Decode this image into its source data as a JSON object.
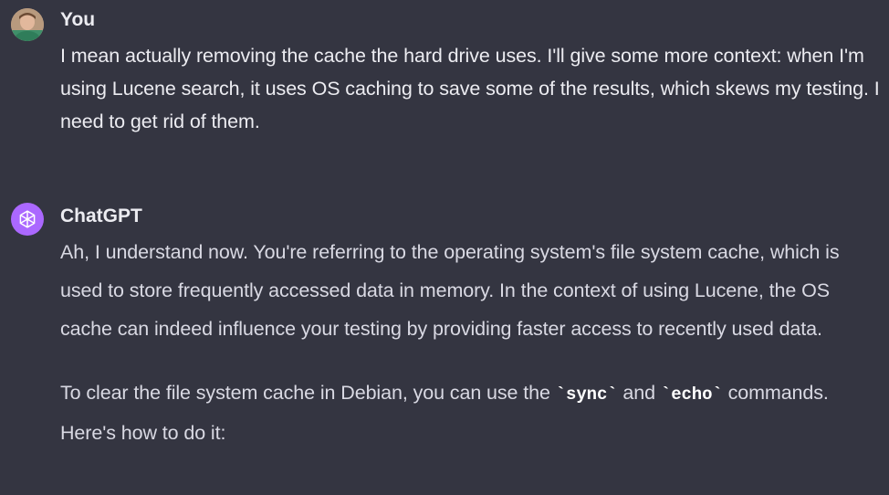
{
  "conversation": {
    "user_message": {
      "author": "You",
      "text": "I mean actually removing the cache the hard drive uses. I'll give some more context: when I'm using Lucene search, it uses OS caching to save some of the results, which skews my testing. I need to get rid of them."
    },
    "assistant_message": {
      "author": "ChatGPT",
      "paragraph_1": "Ah, I understand now. You're referring to the operating system's file system cache, which is used to store frequently accessed data in memory. In the context of using Lucene, the OS cache can indeed influence your testing by providing faster access to recently used data.",
      "paragraph_2_before": "To clear the file system cache in Debian, you can use the ",
      "code_1": "`sync`",
      "paragraph_2_middle": " and ",
      "code_2": "`echo`",
      "paragraph_2_after": " commands. Here's how to do it:"
    }
  },
  "icons": {
    "user_avatar": "user-photo-avatar",
    "assistant_avatar": "openai-logo-icon"
  },
  "colors": {
    "background": "#343541",
    "text": "#ececf1",
    "assistant_avatar_bg": "#ab68ff"
  }
}
